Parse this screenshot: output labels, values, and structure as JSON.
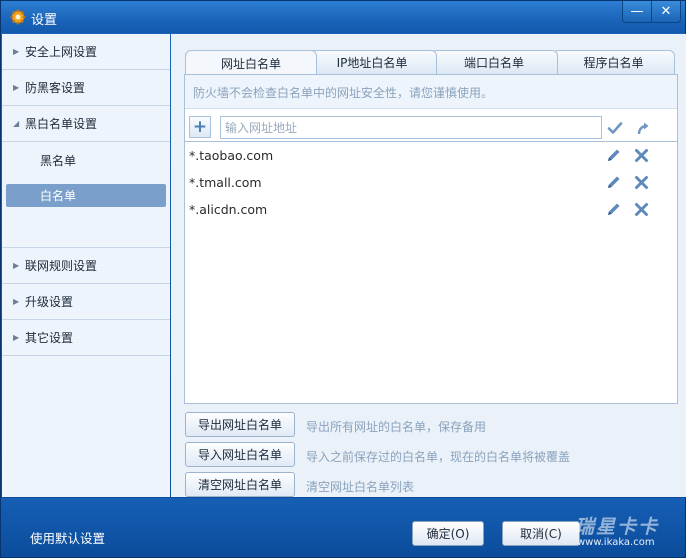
{
  "window": {
    "title": "设置"
  },
  "titlebar": {
    "minimize": "—",
    "close": "✕"
  },
  "sidebar": {
    "items": [
      {
        "label": "安全上网设置",
        "arrow": "▶"
      },
      {
        "label": "防黑客设置",
        "arrow": "▶"
      },
      {
        "label": "黑白名单设置",
        "arrow": "◢"
      },
      {
        "label": "联网规则设置",
        "arrow": "▶"
      },
      {
        "label": "升级设置",
        "arrow": "▶"
      },
      {
        "label": "其它设置",
        "arrow": "▶"
      }
    ],
    "subitems": [
      {
        "label": "黑名单"
      },
      {
        "label": "白名单"
      }
    ]
  },
  "tabs": [
    {
      "label": "网址白名单"
    },
    {
      "label": "IP地址白名单"
    },
    {
      "label": "端口白名单"
    },
    {
      "label": "程序白名单"
    }
  ],
  "panel": {
    "notice": "防火墙不会检查白名单中的网址安全性，请您谨慎使用。",
    "add_label": "+",
    "input_placeholder": "输入网址地址",
    "entries": [
      {
        "url": "*.taobao.com"
      },
      {
        "url": "*.tmall.com"
      },
      {
        "url": "*.alicdn.com"
      }
    ]
  },
  "actions": [
    {
      "label": "导出网址白名单",
      "desc": "导出所有网址的白名单，保存备用"
    },
    {
      "label": "导入网址白名单",
      "desc": "导入之前保存过的白名单，现在的白名单将被覆盖"
    },
    {
      "label": "清空网址白名单",
      "desc": "清空网址白名单列表"
    }
  ],
  "footer": {
    "default_label": "使用默认设置",
    "ok_label": "确定(O)",
    "cancel_label": "取消(C)"
  },
  "watermark": {
    "text": "瑞星卡卡",
    "url": "www.ikaka.com"
  },
  "colors": {
    "titlebar": "#1a63b8",
    "sidebar_bg": "#eef4fb",
    "active_item": "#7a9fca",
    "icon_blue": "#4d7eb4",
    "footer": "#0b4c9b"
  }
}
